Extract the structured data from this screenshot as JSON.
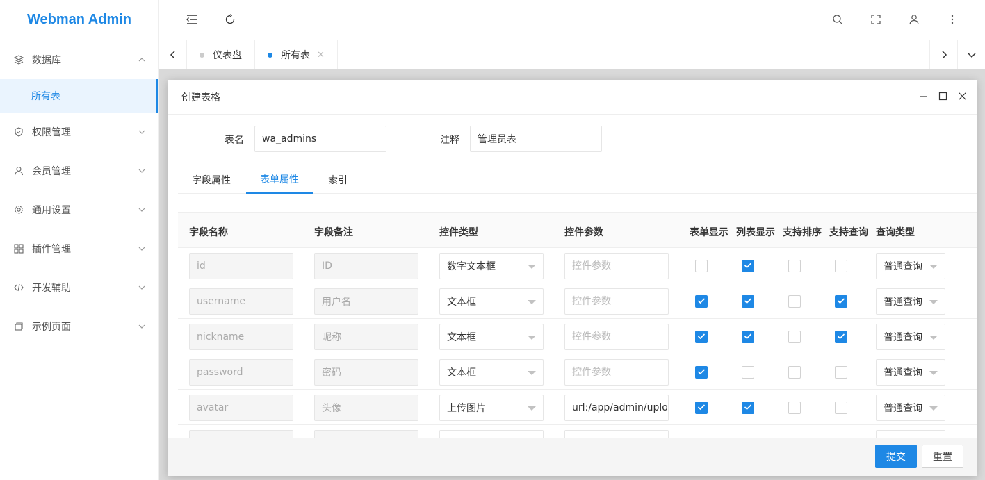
{
  "app": {
    "title": "Webman Admin"
  },
  "sidebar": {
    "items": [
      {
        "label": "数据库",
        "icon": "layers-icon",
        "expanded": true
      },
      {
        "label": "权限管理",
        "icon": "shield-icon"
      },
      {
        "label": "会员管理",
        "icon": "user-icon"
      },
      {
        "label": "通用设置",
        "icon": "gear-icon"
      },
      {
        "label": "插件管理",
        "icon": "apps-icon"
      },
      {
        "label": "开发辅助",
        "icon": "code-icon"
      },
      {
        "label": "示例页面",
        "icon": "page-icon"
      }
    ],
    "sub_active": "所有表"
  },
  "tabs": [
    {
      "label": "仪表盘",
      "active": false
    },
    {
      "label": "所有表",
      "active": true
    }
  ],
  "modal": {
    "title": "创建表格",
    "table_name_label": "表名",
    "table_name_value": "wa_admins",
    "comment_label": "注释",
    "comment_value": "管理员表",
    "form_tabs": [
      "字段属性",
      "表单属性",
      "索引"
    ],
    "active_form_tab": 1,
    "columns": [
      "字段名称",
      "字段备注",
      "控件类型",
      "控件参数",
      "表单显示",
      "列表显示",
      "支持排序",
      "支持查询",
      "查询类型"
    ],
    "param_placeholder": "控件参数",
    "rows": [
      {
        "name": "id",
        "remark": "ID",
        "control": "数字文本框",
        "param": "",
        "form": false,
        "list": true,
        "sort": false,
        "query": false,
        "qtype": "普通查询"
      },
      {
        "name": "username",
        "remark": "用户名",
        "control": "文本框",
        "param": "",
        "form": true,
        "list": true,
        "sort": false,
        "query": true,
        "qtype": "普通查询"
      },
      {
        "name": "nickname",
        "remark": "昵称",
        "control": "文本框",
        "param": "",
        "form": true,
        "list": true,
        "sort": false,
        "query": true,
        "qtype": "普通查询"
      },
      {
        "name": "password",
        "remark": "密码",
        "control": "文本框",
        "param": "",
        "form": true,
        "list": false,
        "sort": false,
        "query": false,
        "qtype": "普通查询"
      },
      {
        "name": "avatar",
        "remark": "头像",
        "control": "上传图片",
        "param": "url:/app/admin/upload",
        "form": true,
        "list": true,
        "sort": false,
        "query": false,
        "qtype": "普通查询"
      }
    ],
    "submit_label": "提交",
    "reset_label": "重置"
  },
  "colors": {
    "accent": "#1e88e5"
  }
}
